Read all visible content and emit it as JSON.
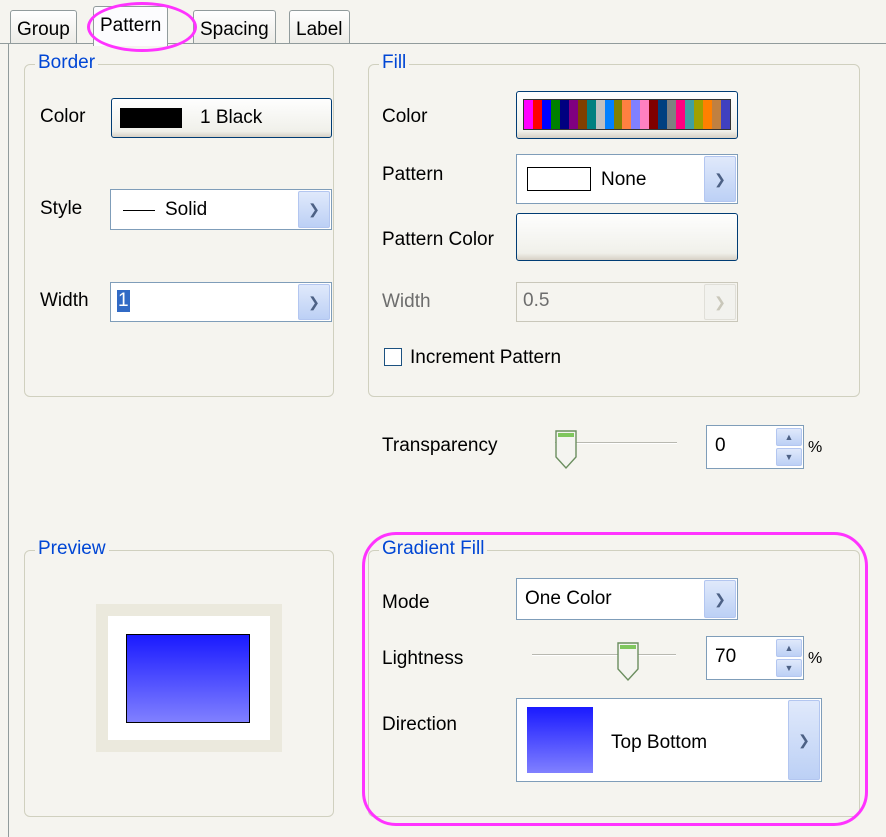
{
  "tabs": [
    {
      "label": "Group"
    },
    {
      "label": "Pattern"
    },
    {
      "label": "Spacing"
    },
    {
      "label": "Label"
    }
  ],
  "border": {
    "title": "Border",
    "color_label": "Color",
    "color_value": "1 Black",
    "color_swatch": "#000000",
    "style_label": "Style",
    "style_value": "Solid",
    "width_label": "Width",
    "width_value": "1"
  },
  "fill": {
    "title": "Fill",
    "color_label": "Color",
    "palette": [
      "#ff00ff",
      "#ff0000",
      "#0000ff",
      "#008000",
      "#000080",
      "#800080",
      "#804000",
      "#008080",
      "#c0c0c0",
      "#0080ff",
      "#808000",
      "#ff8040",
      "#8080ff",
      "#ff80c0",
      "#800000",
      "#004080",
      "#808080",
      "#ff0080",
      "#40a0a0",
      "#a0a000",
      "#ff8000",
      "#c08040",
      "#4040c0"
    ],
    "pattern_label": "Pattern",
    "pattern_value": "None",
    "pattern_color_label": "Pattern Color",
    "width_label": "Width",
    "width_value": "0.5",
    "increment_label": "Increment Pattern",
    "increment_checked": false
  },
  "transparency": {
    "label": "Transparency",
    "value": "0",
    "unit": "%",
    "level": 0
  },
  "preview": {
    "title": "Preview"
  },
  "gradient": {
    "title": "Gradient Fill",
    "mode_label": "Mode",
    "mode_value": "One Color",
    "lightness_label": "Lightness",
    "lightness_value": "70",
    "lightness_unit": "%",
    "lightness_level": 70,
    "direction_label": "Direction",
    "direction_value": "Top Bottom"
  },
  "colors": {
    "highlight": "#ff33ff",
    "accent": "#0046d5",
    "gradient_top": "#1a1aff",
    "gradient_bottom": "#8080ff"
  }
}
